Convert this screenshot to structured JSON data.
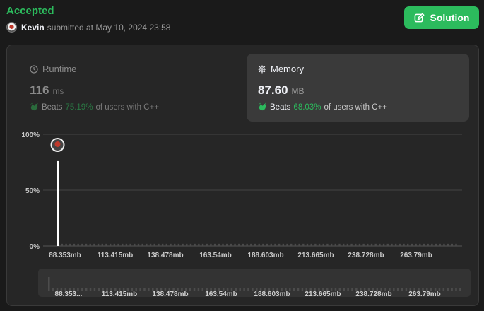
{
  "submission": {
    "status": "Accepted",
    "username": "Kevin",
    "submitted_text": "submitted at May 10, 2024 23:58"
  },
  "solution_button": {
    "label": "Solution"
  },
  "runtime": {
    "title": "Runtime",
    "value": "116",
    "unit": "ms",
    "beats_label": "Beats",
    "beats_pct": "75.19%",
    "beats_suffix": "of users with C++"
  },
  "memory": {
    "title": "Memory",
    "value": "87.60",
    "unit": "MB",
    "beats_label": "Beats",
    "beats_pct": "68.03%",
    "beats_suffix": "of users with C++"
  },
  "colors": {
    "accent": "#2cbb5d",
    "panel": "#262626",
    "card_active": "#3a3a3a"
  },
  "chart_data": {
    "type": "bar",
    "y_tick_labels": [
      "100%",
      "50%",
      "0%"
    ],
    "ylim": [
      0,
      100
    ],
    "x_tick_labels": [
      "88.353mb",
      "113.415mb",
      "138.478mb",
      "163.54mb",
      "188.603mb",
      "213.665mb",
      "238.728mb",
      "263.79mb"
    ],
    "highlight_index": 0,
    "values": [
      76,
      2,
      2,
      2,
      2,
      2,
      2,
      2,
      2,
      2,
      2,
      2,
      2,
      2,
      2,
      2,
      2,
      2,
      2,
      2,
      2,
      2,
      2,
      2,
      2,
      2,
      2,
      2,
      2,
      2,
      2,
      2,
      2,
      2,
      2,
      2,
      2,
      2,
      2,
      2,
      2,
      2,
      2,
      2,
      2,
      2,
      2,
      2,
      2,
      2,
      2,
      2,
      2,
      2,
      2,
      2,
      2,
      2,
      2,
      2,
      2,
      2,
      2,
      2,
      2,
      2,
      2,
      2,
      2,
      2,
      2,
      2,
      2,
      2,
      2,
      2,
      2,
      2,
      2,
      2,
      2,
      2,
      2,
      2,
      2,
      2,
      2,
      2,
      2,
      2,
      2,
      2,
      2,
      2,
      2,
      2,
      2,
      2,
      2,
      2
    ],
    "grid": true,
    "mini_x_tick_labels": [
      "88.353...",
      "113.415mb",
      "138.478mb",
      "163.54mb",
      "188.603mb",
      "213.665mb",
      "238.728mb",
      "263.79mb"
    ]
  }
}
